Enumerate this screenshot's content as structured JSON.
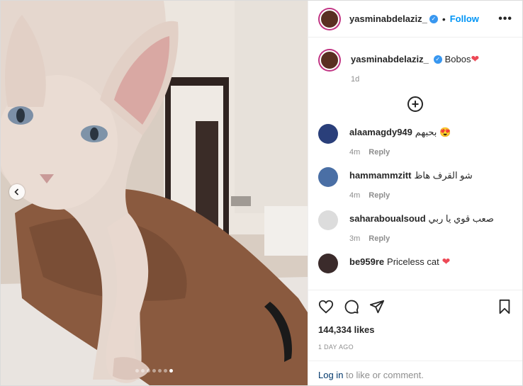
{
  "post": {
    "author": "yasminabdelaziz_",
    "verified_icon": "verified-badge-icon",
    "separator": "•",
    "follow_label": "Follow",
    "more_icon": "more-options-icon",
    "more_label": "•••",
    "caption_text": "Bobos",
    "caption_emoji": "❤",
    "caption_time": "1d",
    "load_more_label": "+",
    "likes": "144,334 likes",
    "date": "1 DAY AGO",
    "login_link": "Log in",
    "login_text": "to like or comment."
  },
  "media": {
    "image_description_icon": "sphynx-cat-photo",
    "carousel_dots": 7,
    "active_dot": 6
  },
  "comments": [
    {
      "user": "alaamagdy949",
      "text": "بحبهم 😍",
      "time": "4m",
      "reply": "Reply",
      "avatar_color": "#2a3f7a"
    },
    {
      "user": "hammammzitt",
      "text": "شو القرف هاظ",
      "time": "4m",
      "reply": "Reply",
      "avatar_color": "#4a6fa5"
    },
    {
      "user": "saharaboualsoud",
      "text": "صعب قوي يا ربي",
      "time": "3m",
      "reply": "Reply",
      "avatar_color": "#dcdcdc"
    },
    {
      "user": "be959re",
      "text": "Priceless cat",
      "heart": "❤",
      "avatar_color": "#3b2b2b"
    }
  ],
  "colors": {
    "accent": "#0095f6",
    "heart": "#ed4956",
    "verified": "#3897f0"
  }
}
